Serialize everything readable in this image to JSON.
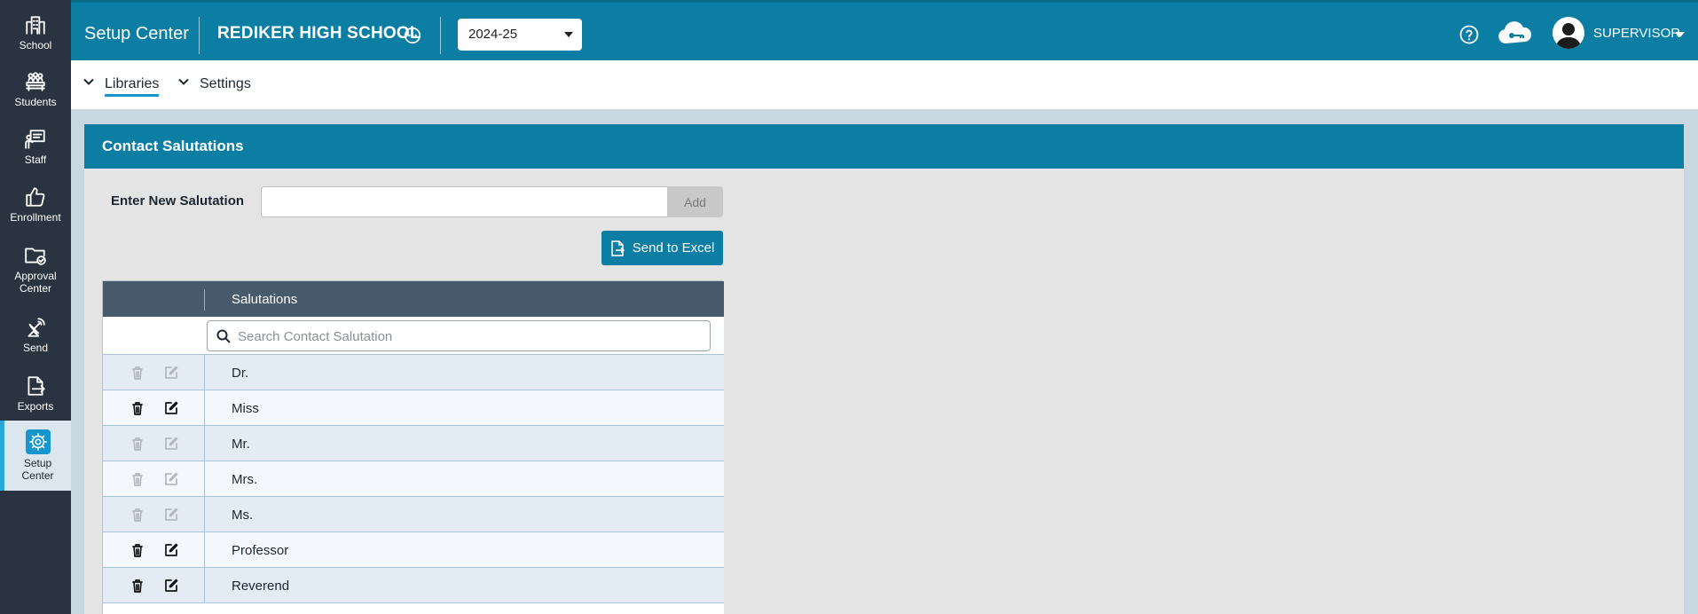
{
  "sidebar": {
    "items": [
      {
        "label": "School",
        "icon": "school-icon"
      },
      {
        "label": "Students",
        "icon": "students-icon"
      },
      {
        "label": "Staff",
        "icon": "staff-icon"
      },
      {
        "label": "Enrollment",
        "icon": "thumbs-up-icon"
      },
      {
        "label": "Approval Center",
        "icon": "folder-check-icon"
      },
      {
        "label": "Send",
        "icon": "satellite-icon"
      },
      {
        "label": "Exports",
        "icon": "export-icon"
      },
      {
        "label": "Setup Center",
        "icon": "gear-icon",
        "active": true
      }
    ]
  },
  "header": {
    "title": "Setup Center",
    "school": "REDIKER HIGH SCHOOL",
    "year": "2024-25",
    "user": "SUPERVISOR"
  },
  "subnav": {
    "libraries": "Libraries",
    "settings": "Settings"
  },
  "panel": {
    "title": "Contact Salutations",
    "new_label": "Enter New Salutation",
    "new_value": "",
    "add_label": "Add",
    "excel_label": "Send to Excel"
  },
  "table": {
    "column": "Salutations",
    "search_placeholder": "Search Contact Salutation",
    "rows": [
      {
        "value": "Dr.",
        "editable": false
      },
      {
        "value": "Miss",
        "editable": true
      },
      {
        "value": "Mr.",
        "editable": false
      },
      {
        "value": "Mrs.",
        "editable": false
      },
      {
        "value": "Ms.",
        "editable": false
      },
      {
        "value": "Professor",
        "editable": true
      },
      {
        "value": "Reverend",
        "editable": true
      }
    ]
  },
  "colors": {
    "brand": "#0d7ea3",
    "sidebar": "#2a3440",
    "table_header": "#475a6b",
    "active_accent": "#1596cc"
  }
}
